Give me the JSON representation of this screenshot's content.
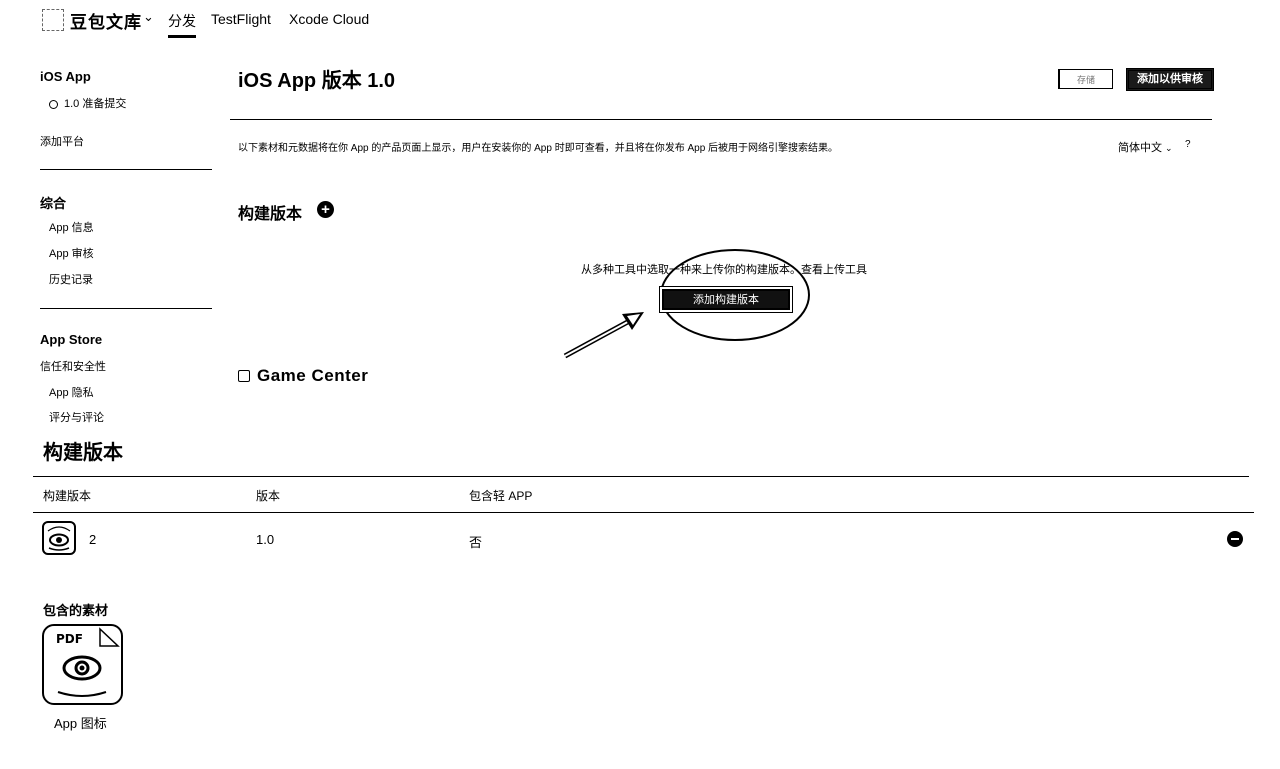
{
  "topnav": {
    "app_name": "豆包文库",
    "tabs": [
      "分发",
      "TestFlight",
      "Xcode Cloud"
    ]
  },
  "sidebar": {
    "ios_app_heading": "iOS App",
    "version_status": "1.0 准备提交",
    "add_platform": "添加平台",
    "general_heading": "综合",
    "general_items": [
      "App 信息",
      "App 审核",
      "历史记录"
    ],
    "appstore_heading": "App Store",
    "trust_safety": "信任和安全性",
    "appstore_items": [
      "App 隐私",
      "评分与评论"
    ]
  },
  "main": {
    "title": "iOS App 版本 1.0",
    "save_label": "存储",
    "submit_label": "添加以供审核",
    "description": "以下素材和元数据将在你 App 的产品页面上显示，用户在安装你的 App 时即可查看，并且将在你发布 App 后被用于网络引擎搜索结果。",
    "language": "简体中文",
    "help": "?",
    "build_section_title": "构建版本",
    "upload_hint": "从多种工具中选取一种来上传你的构建版本。查看上传工具",
    "add_build_label": "添加构建版本",
    "game_center_label": "Game Center"
  },
  "builds_panel": {
    "title": "构建版本",
    "columns": [
      "构建版本",
      "版本",
      "包含轻 APP"
    ],
    "rows": [
      {
        "build": "2",
        "version": "1.0",
        "includes_clip": "否"
      }
    ]
  },
  "assets": {
    "title": "包含的素材",
    "icon_badge": "PDF",
    "icon_label": "App 图标"
  },
  "icons": [
    "chevron-down-icon",
    "plus-circle-icon",
    "minus-circle-icon",
    "status-circle-icon",
    "checkbox-icon",
    "pdf-eye-icon",
    "arrow-icon"
  ]
}
